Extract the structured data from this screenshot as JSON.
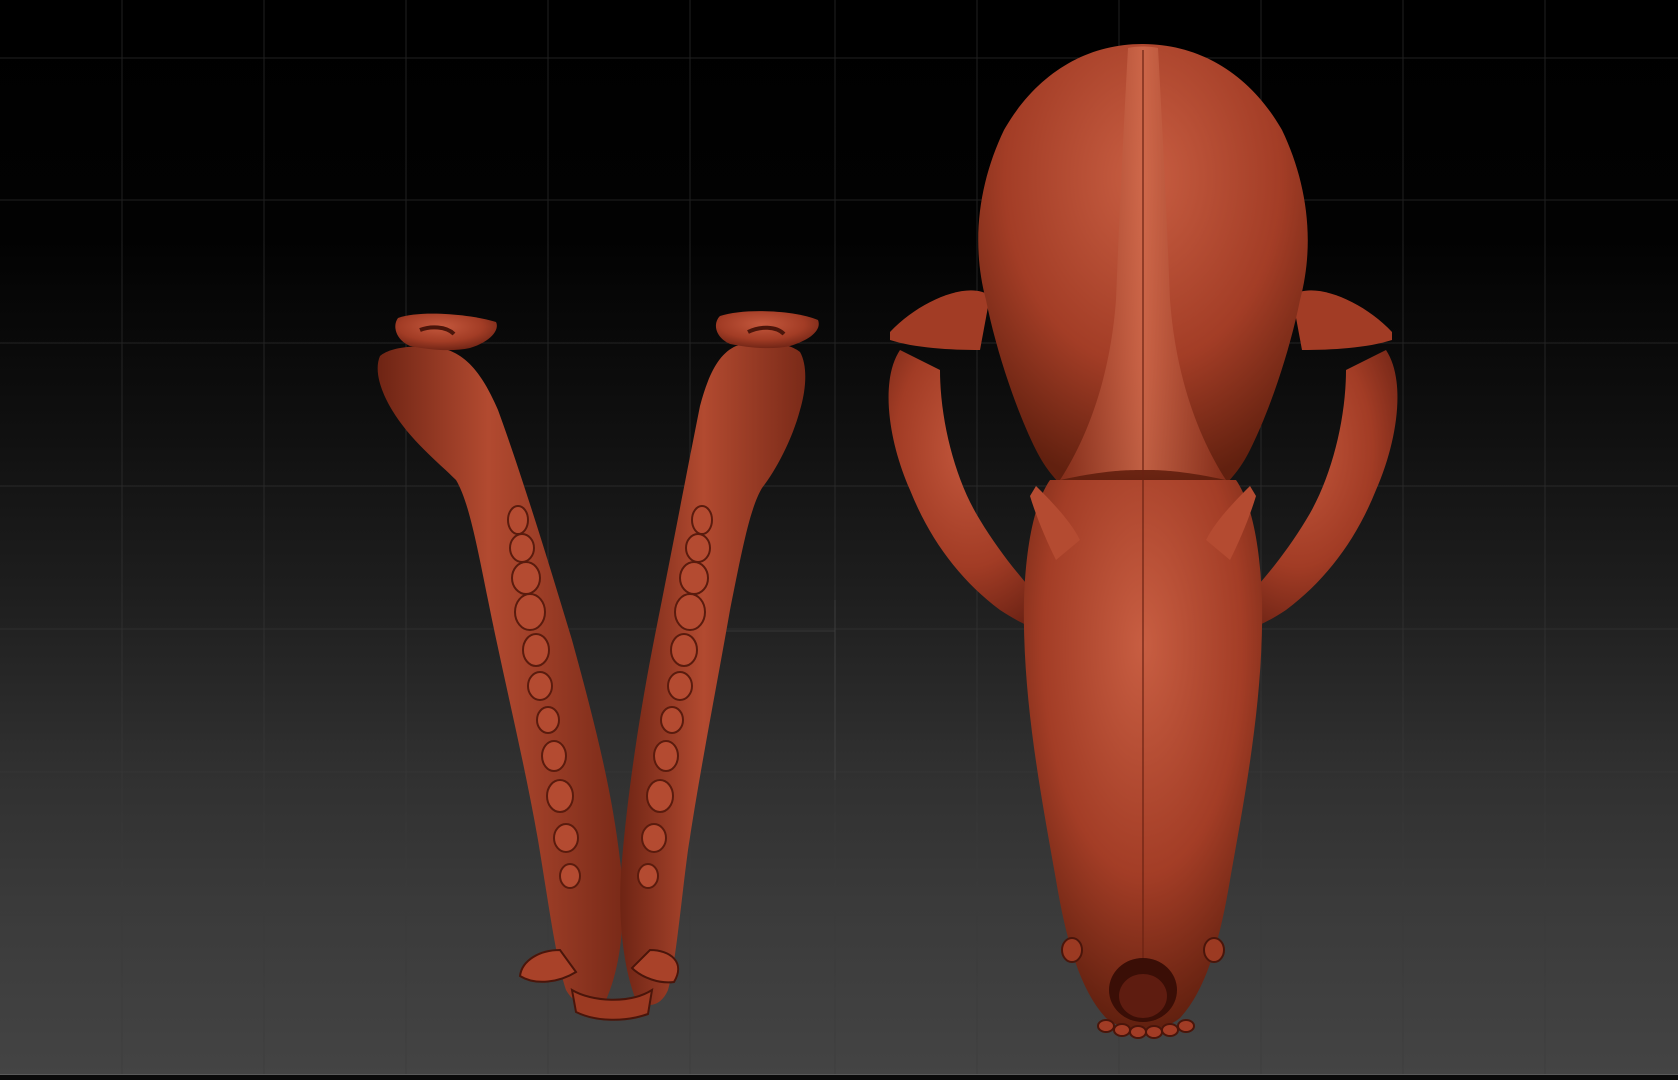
{
  "app": {
    "type": "3d-sculpting-viewport"
  },
  "colors": {
    "material": "#a23c25",
    "material_light": "#c4583d",
    "material_dark": "#5e1c10",
    "grid_line": "#3c3c3c",
    "background_top": "#000000",
    "background_bottom": "#444444"
  },
  "scene": {
    "objects": [
      {
        "id": "mandible",
        "description_icon": "mandible-model"
      },
      {
        "id": "cranium",
        "description_icon": "cranium-model"
      }
    ]
  }
}
